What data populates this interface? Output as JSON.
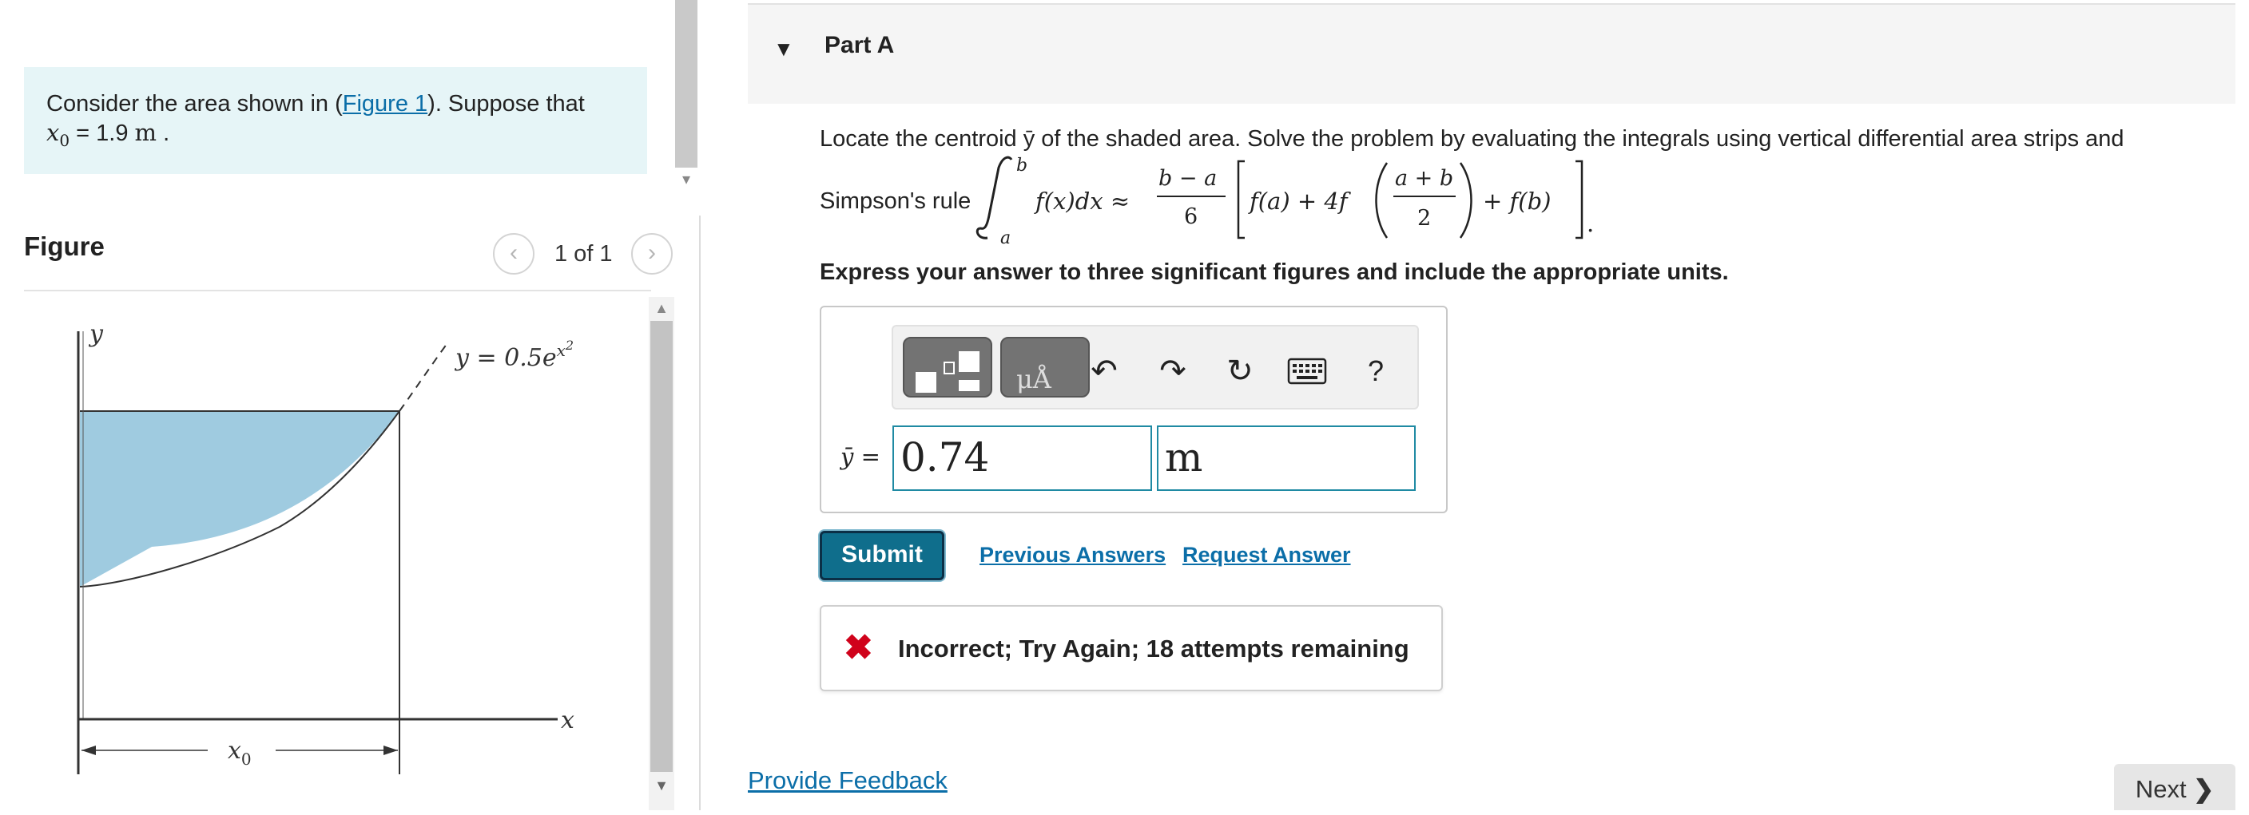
{
  "problem": {
    "text_before_link": "Consider the area shown in (",
    "figure_link": "Figure 1",
    "text_after_link": "). Suppose that",
    "x0_symbol": "x",
    "x0_subscript": "0",
    "x0_value": " = 1.9 ",
    "x0_unit": "m",
    "period": " ."
  },
  "figure": {
    "title": "Figure",
    "counter": "1 of 1",
    "prev_icon": "chevron-left-icon",
    "next_icon": "chevron-right-icon",
    "y_axis_label": "y",
    "x_axis_label": "x",
    "curve_label_prefix": "y = 0.5e",
    "curve_label_exp_var": "x",
    "curve_label_exp_pow": "2",
    "x0_label": "x",
    "x0_label_sub": "0",
    "fill_color": "#9fcbe0"
  },
  "part": {
    "title": "Part A",
    "instruction": "Locate the centroid ȳ of the shaded area. Solve the problem by evaluating the integrals using vertical differential area strips and",
    "simpson_label": "Simpson's rule",
    "formula": {
      "upper": "b",
      "lower": "a",
      "integrand": "f(x)dx ≈",
      "frac_num": "b − a",
      "frac_den": "6",
      "term1": "f(a) + 4f",
      "inner_num": "a + b",
      "inner_den": "2",
      "term2": "+ f(b)",
      "end": "."
    },
    "express": "Express your answer to three significant figures and include the appropriate units."
  },
  "toolbar": {
    "template_icon": "templates-icon",
    "units_icon": "units-icon",
    "units_glyph": "μÅ",
    "undo_icon": "undo-icon",
    "redo_icon": "redo-icon",
    "reset_icon": "reset-icon",
    "keyboard_icon": "keyboard-icon",
    "help_label": "?"
  },
  "answer": {
    "label": "ȳ =",
    "value": "0.74",
    "unit": "m"
  },
  "actions": {
    "submit": "Submit",
    "previous_answers": "Previous Answers",
    "request_answer": "Request Answer"
  },
  "feedback": {
    "icon": "x-icon",
    "message": "Incorrect; Try Again; 18 attempts remaining",
    "color": "#d0021b"
  },
  "footer": {
    "provide_feedback": "Provide Feedback",
    "next": "Next"
  },
  "colors": {
    "accent": "#0f6e8c",
    "link": "#0b6ea8",
    "problem_bg": "#e6f5f7"
  }
}
